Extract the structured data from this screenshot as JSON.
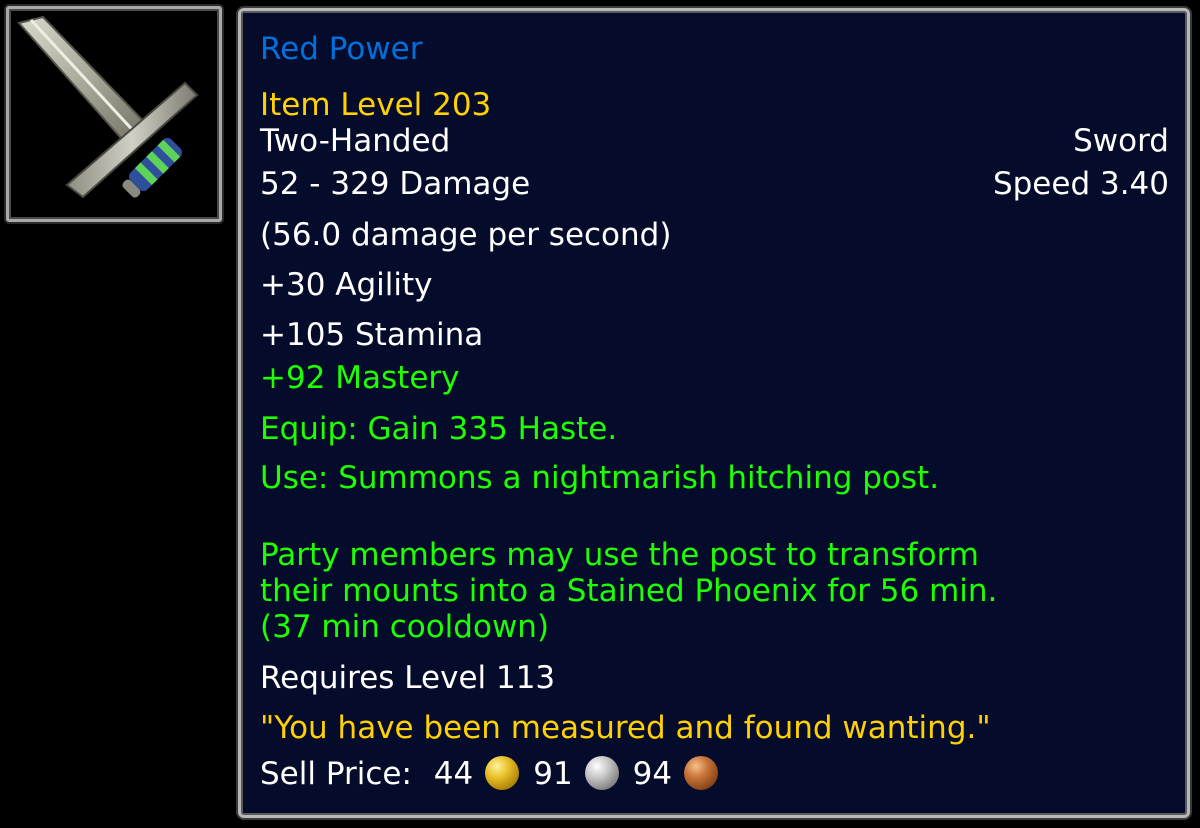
{
  "icon": {
    "name": "sword-icon"
  },
  "item": {
    "name": "Red Power",
    "item_level": "Item Level 203",
    "hand": "Two-Handed",
    "type": "Sword",
    "damage": "52 - 329 Damage",
    "speed": "Speed 3.40",
    "dps": "(56.0 damage per second)",
    "stat_agility": "+30 Agility",
    "stat_stamina": "+105 Stamina",
    "stat_mastery": "+92 Mastery",
    "equip": "Equip: Gain 335 Haste.",
    "use_line1": "Use: Summons a nightmarish hitching post.",
    "use_line2": "Party members may use the post to transform",
    "use_line3": "their mounts into a Stained Phoenix for 56 min.",
    "use_line4": "(37 min cooldown)",
    "requires": "Requires Level 113",
    "flavor": "\"You have been measured and found wanting.\""
  },
  "sell_price": {
    "label": "Sell Price:",
    "gold": "44",
    "silver": "91",
    "copper": "94"
  },
  "colors": {
    "name_quality": "#0070dd",
    "item_level": "#ffd100",
    "bonus_text": "#1eff00",
    "flavor_text": "#ffd100",
    "panel_bg": "#050b2a"
  }
}
